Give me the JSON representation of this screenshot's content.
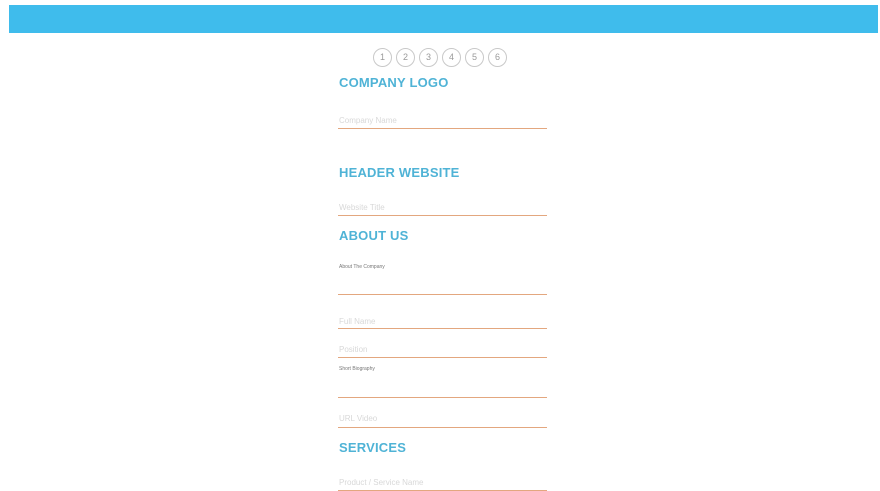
{
  "header": {
    "bar_color": "#3fbcec"
  },
  "steps": [
    "1",
    "2",
    "3",
    "4",
    "5",
    "6"
  ],
  "sections": {
    "company_logo": {
      "title": "COMPANY LOGO",
      "company_name_placeholder": "Company Name"
    },
    "header_website": {
      "title": "HEADER WEBSITE",
      "website_title_placeholder": "Website Title"
    },
    "about_us": {
      "title": "ABOUT US",
      "about_label": "About The Company",
      "full_name_placeholder": "Full Name",
      "position_placeholder": "Position",
      "short_bio_label": "Short Biography",
      "url_placeholder": "URL Video"
    },
    "services": {
      "title": "SERVICES",
      "service_name_placeholder": "Product / Service Name"
    }
  },
  "colors": {
    "accent": "#3fbcec",
    "title": "#4fb3d6",
    "underline": "#e3a77f"
  }
}
